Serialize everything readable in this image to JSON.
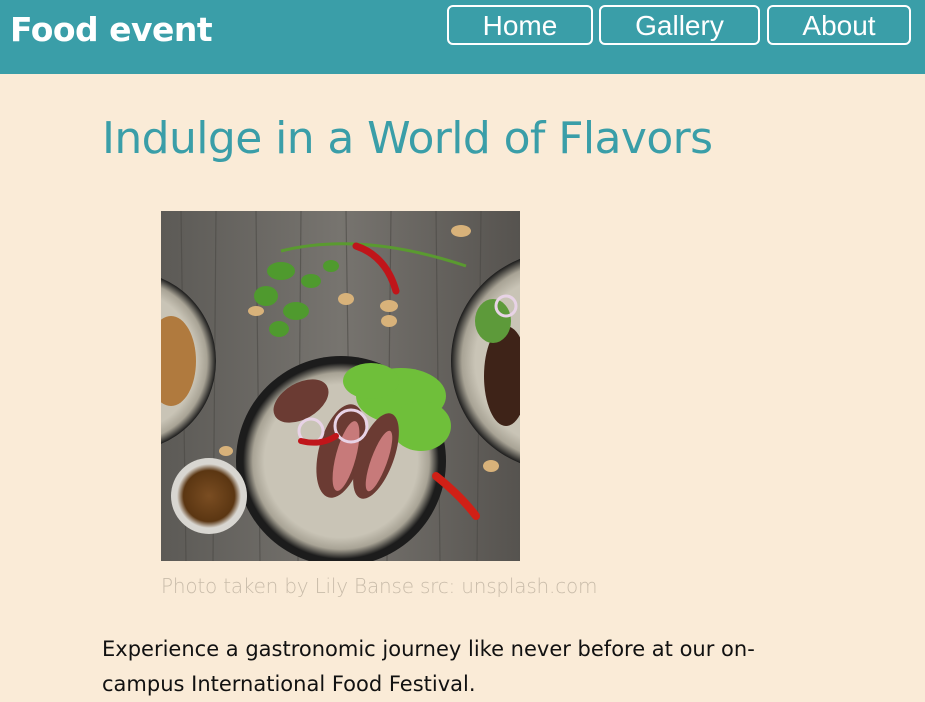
{
  "header": {
    "brand": "Food event",
    "nav": {
      "home": "Home",
      "gallery": "Gallery",
      "about": "About"
    },
    "bg_color": "#3a9ea8"
  },
  "main": {
    "title": "Indulge in a World of Flavors",
    "photo": {
      "caption": "Photo taken by Lily Banse src: unsplash.com"
    },
    "intro": "Experience a gastronomic journey like never before at our on-campus International Food Festival."
  },
  "colors": {
    "page_bg": "#faebd7",
    "accent": "#3a9ea8",
    "caption": "#c9bcaa"
  }
}
